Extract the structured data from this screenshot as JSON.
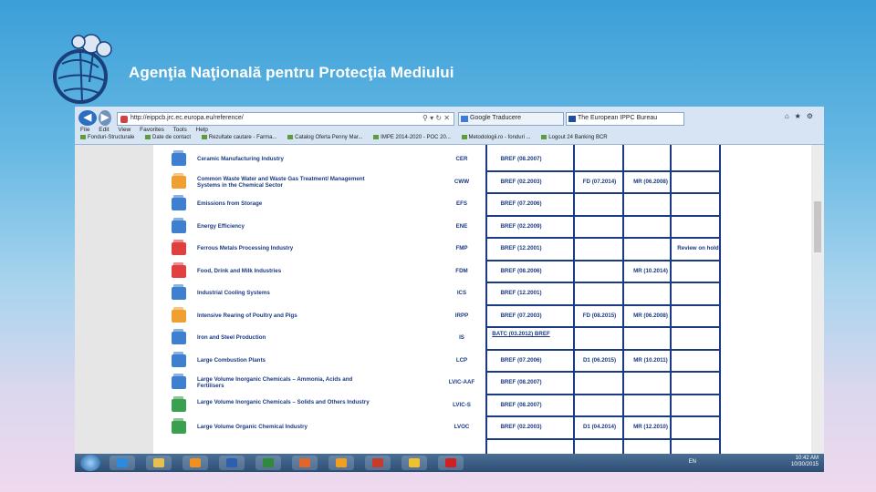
{
  "slide": {
    "title": "Agenţia Naţională pentru Protecţia Mediului"
  },
  "browser": {
    "address": "http://eippcb.jrc.ec.europa.eu/reference/",
    "tabs": [
      "Google Traducere",
      "The European IPPC Bureau"
    ],
    "menu": [
      "File",
      "Edit",
      "View",
      "Favorites",
      "Tools",
      "Help"
    ],
    "favorites": [
      "Fonduri-Structurale",
      "Date de contact",
      "Rezultate cautare - Farma...",
      "Catalog Oferta Penny Mar...",
      "IMPE 2014-2020 - POC 20...",
      "Metodologii.ro - fonduri ...",
      "Logout 24 Banking BCR"
    ]
  },
  "table": {
    "rows": [
      {
        "name": "Ceramic Manufacturing Industry",
        "code": "CER",
        "bref": "BREF (08.2007)",
        "c2": "",
        "c3": "",
        "c4": "",
        "color": "#3f7fcf"
      },
      {
        "name": "Common Waste Water and Waste Gas Treatment/ Management Systems in the Chemical Sector",
        "code": "CWW",
        "bref": "BREF (02.2003)",
        "c2": "FD (07.2014)",
        "c3": "MR (06.2008)",
        "c4": "",
        "color": "#f0a030"
      },
      {
        "name": "Emissions from Storage",
        "code": "EFS",
        "bref": "BREF (07.2006)",
        "c2": "",
        "c3": "",
        "c4": "",
        "color": "#3f7fcf"
      },
      {
        "name": "Energy Efficiency",
        "code": "ENE",
        "bref": "BREF (02.2009)",
        "c2": "",
        "c3": "",
        "c4": "",
        "color": "#3f7fcf"
      },
      {
        "name": "Ferrous Metals Processing Industry",
        "code": "FMP",
        "bref": "BREF (12.2001)",
        "c2": "",
        "c3": "",
        "c4": "Review on hold",
        "color": "#e04040"
      },
      {
        "name": "Food, Drink and Milk Industries",
        "code": "FDM",
        "bref": "BREF (08.2006)",
        "c2": "",
        "c3": "MR (10.2014)",
        "c4": "",
        "color": "#e04040"
      },
      {
        "name": "Industrial Cooling Systems",
        "code": "ICS",
        "bref": "BREF (12.2001)",
        "c2": "",
        "c3": "",
        "c4": "",
        "color": "#3f7fcf"
      },
      {
        "name": "Intensive Rearing of Poultry and Pigs",
        "code": "IRPP",
        "bref": "BREF (07.2003)",
        "c2": "FD (08.2015)",
        "c3": "MR (06.2008)",
        "c4": "",
        "color": "#f0a030"
      },
      {
        "name": "Iron and Steel Production",
        "code": "IS",
        "bref": "BATC (03.2012) BREF",
        "c2": "",
        "c3": "",
        "c4": "",
        "color": "#3f7fcf"
      },
      {
        "name": "Large Combustion Plants",
        "code": "LCP",
        "bref": "BREF (07.2006)",
        "c2": "D1 (06.2015)",
        "c3": "MR (10.2011)",
        "c4": "",
        "color": "#3f7fcf"
      },
      {
        "name": "Large Volume Inorganic Chemicals – Ammonia, Acids and Fertilisers",
        "code": "LVIC-AAF",
        "bref": "BREF (08.2007)",
        "c2": "",
        "c3": "",
        "c4": "",
        "color": "#3f7fcf"
      },
      {
        "name": "Large Volume Inorganic Chemicals – Solids and Others Industry",
        "code": "LVIC-S",
        "bref": "BREF (08.2007)",
        "c2": "",
        "c3": "",
        "c4": "",
        "color": "#3aa050"
      },
      {
        "name": "Large Volume Organic Chemical Industry",
        "code": "LVOC",
        "bref": "BREF (02.2003)",
        "c2": "D1 (04.2014)",
        "c3": "MR (12.2010)",
        "c4": "",
        "color": "#3aa050"
      }
    ]
  },
  "taskbar": {
    "lang": "EN",
    "time": "10:42 AM",
    "date": "10/30/2015"
  }
}
